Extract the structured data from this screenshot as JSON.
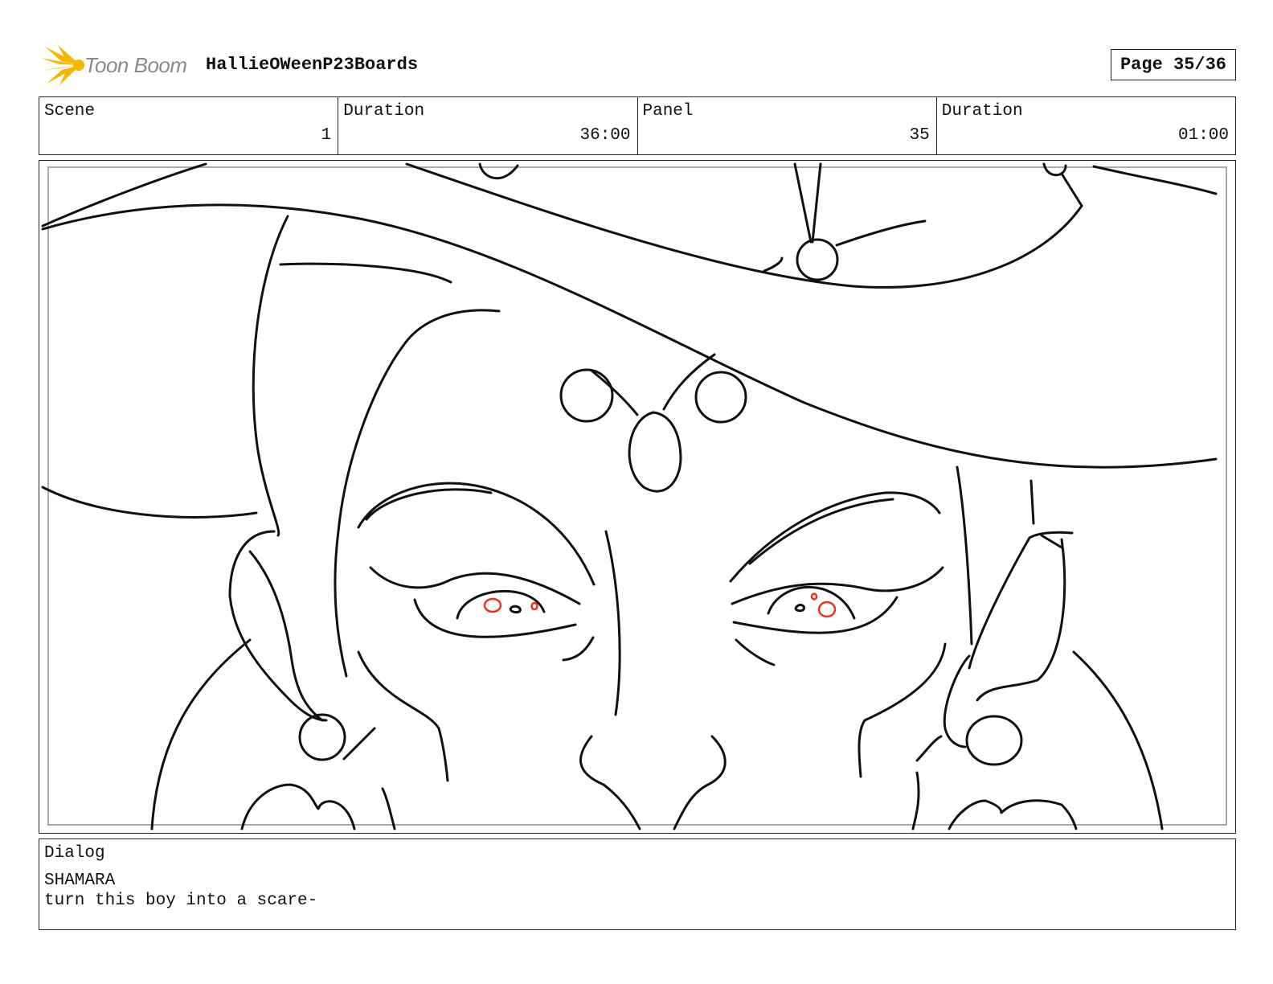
{
  "header": {
    "logo_text": "Toon Boom",
    "title": "HallieOWeenP23Boards",
    "page_label": "Page 35/36"
  },
  "info": {
    "scene_label": "Scene",
    "scene_value": "1",
    "scene_duration_label": "Duration",
    "scene_duration_value": "36:00",
    "panel_label": "Panel",
    "panel_value": "35",
    "panel_duration_label": "Duration",
    "panel_duration_value": "01:00"
  },
  "dialog": {
    "label": "Dialog",
    "speaker": "SHAMARA",
    "line": "turn this boy into a scare-"
  },
  "colors": {
    "line_art": "#111111",
    "eye_accent": "#e8341c",
    "logo_accent": "#f5b800"
  },
  "icons": {
    "logo": "toon-boom-sunburst-icon",
    "panel": "storyboard-sketch"
  }
}
